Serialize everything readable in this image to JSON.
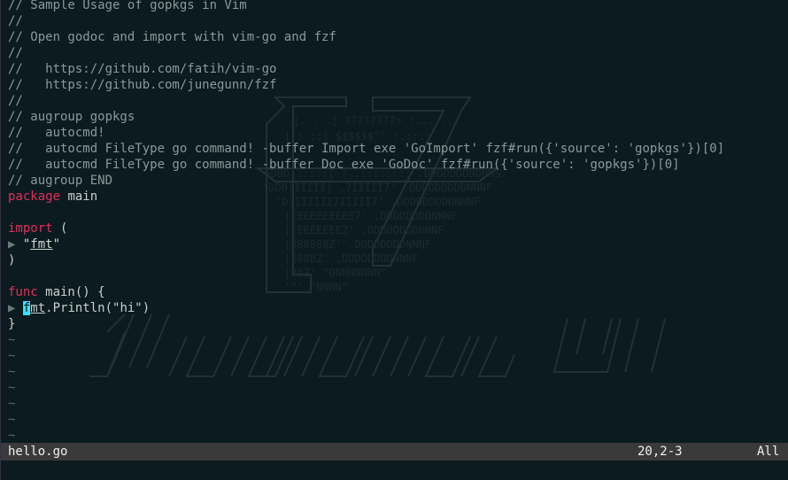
{
  "editor": {
    "comments": [
      "// Sample Usage of gopkgs in Vim",
      "//",
      "// Open godoc and import with vim-go and fzf",
      "//",
      "//   https://github.com/fatih/vim-go",
      "//   https://github.com/junegunn/fzf",
      "//",
      "// augroup gopkgs",
      "//   autocmd!",
      "//   autocmd FileType go command! -buffer Import exe 'GoImport' fzf#run({'source': 'gopkgs'})[0]",
      "//   autocmd FileType go command! -buffer Doc exe 'GoDoc' fzf#run({'source': 'gopkgs'})[0]",
      "// augroup END"
    ],
    "package_kw": "package",
    "package_name": " main",
    "import_kw": "import",
    "import_open": " (",
    "fold_marker": "▶ ",
    "import_q1": "\"",
    "import_pkg": "fmt",
    "import_q2": "\"",
    "close_paren": ")",
    "func_kw": "func",
    "func_sig": " main() {",
    "cursor_char": "f",
    "call_pkg_rest": "mt",
    "call_rest": ".Println(\"hi\")",
    "close_brace": "}",
    "tilde": "~"
  },
  "statusline": {
    "filename": "hello.go",
    "position": "20,2-3",
    "scroll": "All"
  }
}
